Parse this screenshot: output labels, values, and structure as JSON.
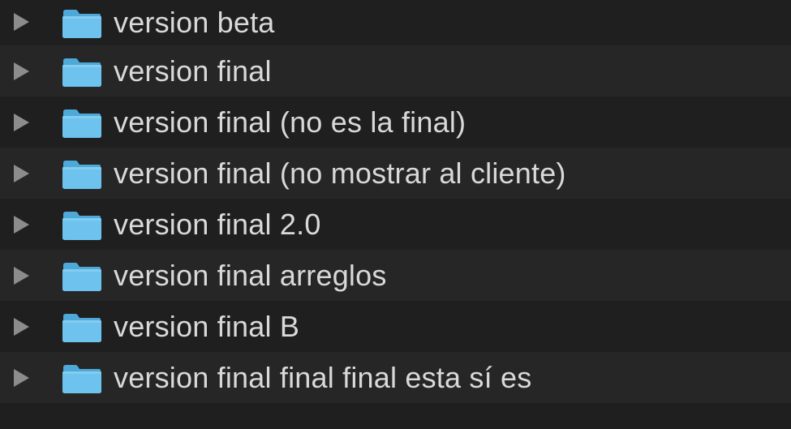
{
  "folders": [
    {
      "name": "version beta"
    },
    {
      "name": "version final"
    },
    {
      "name": "version final (no es la final)"
    },
    {
      "name": "version final (no mostrar al cliente)"
    },
    {
      "name": "version final 2.0"
    },
    {
      "name": "version final arreglos"
    },
    {
      "name": "version final B"
    },
    {
      "name": "version final final final esta sí es"
    }
  ],
  "icons": {
    "disclosure": "disclosure-triangle-right-icon",
    "folder": "folder-icon"
  },
  "colors": {
    "background_row_odd": "#1f1f1f",
    "background_row_even": "#262626",
    "text": "#d9d9d9",
    "triangle": "#8c8c8c",
    "folder_body": "#6ec3ee",
    "folder_tab": "#4fa9d8"
  }
}
